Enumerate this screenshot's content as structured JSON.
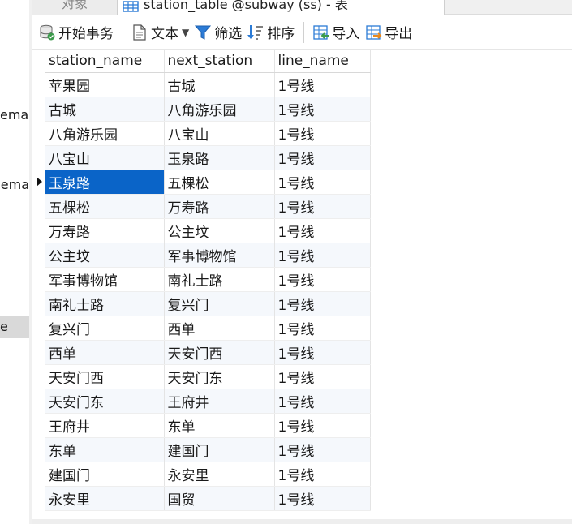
{
  "left_panel": {
    "items": [
      {
        "label": "ema",
        "selected": false
      },
      {
        "label": "nema",
        "selected": false
      },
      {
        "label": "e",
        "selected": true
      }
    ]
  },
  "tabs": {
    "inactive_label": "对象",
    "active_label": "station_table @subway (ss) - 表"
  },
  "toolbar": {
    "begin_transaction": "开始事务",
    "text": "文本",
    "filter": "筛选",
    "sort": "排序",
    "import": "导入",
    "export": "导出"
  },
  "grid": {
    "columns": [
      "station_name",
      "next_station",
      "line_name"
    ],
    "selected_row": 4,
    "rows": [
      [
        "苹果园",
        "古城",
        "1号线"
      ],
      [
        "古城",
        "八角游乐园",
        "1号线"
      ],
      [
        "八角游乐园",
        "八宝山",
        "1号线"
      ],
      [
        "八宝山",
        "玉泉路",
        "1号线"
      ],
      [
        "玉泉路",
        "五棵松",
        "1号线"
      ],
      [
        "五棵松",
        "万寿路",
        "1号线"
      ],
      [
        "万寿路",
        "公主坟",
        "1号线"
      ],
      [
        "公主坟",
        "军事博物馆",
        "1号线"
      ],
      [
        "军事博物馆",
        "南礼士路",
        "1号线"
      ],
      [
        "南礼士路",
        "复兴门",
        "1号线"
      ],
      [
        "复兴门",
        "西单",
        "1号线"
      ],
      [
        "西单",
        "天安门西",
        "1号线"
      ],
      [
        "天安门西",
        "天安门东",
        "1号线"
      ],
      [
        "天安门东",
        "王府井",
        "1号线"
      ],
      [
        "王府井",
        "东单",
        "1号线"
      ],
      [
        "东单",
        "建国门",
        "1号线"
      ],
      [
        "建国门",
        "永安里",
        "1号线"
      ],
      [
        "永安里",
        "国贸",
        "1号线"
      ]
    ]
  },
  "colors": {
    "selection": "#0a64c8",
    "alt_row": "#f5f8fc",
    "toolbar_icon_blue": "#2b7bd6",
    "toolbar_icon_orange": "#e8891d",
    "toolbar_icon_green": "#3c9a4c"
  }
}
